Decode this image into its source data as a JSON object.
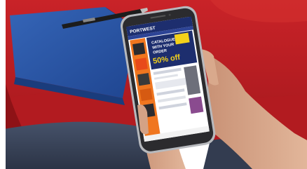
{
  "photo": {
    "subject": "hand-holding-smartphone",
    "colors": {
      "sofa": "#c21f24",
      "sofa_dark": "#8e1216",
      "notebook": "#2a57a8",
      "notebook_dark": "#1a3c7c",
      "pen": "#1a1a1a",
      "phone_frame": "#2b2b2e",
      "phone_edge": "#b7b9bd",
      "skin": "#d9a98c",
      "skin_shadow": "#b98466",
      "jeans": "#3a4458",
      "site_header": "#1d2e6e",
      "promo_orange": "#f0761f",
      "promo_yellow": "#f4d21a"
    }
  },
  "phone_screen": {
    "brand": "PORTWEST",
    "promo_line_1": "CATALOGUE",
    "promo_line_2": "WITH YOUR",
    "promo_line_3": "ORDER",
    "discount": "50% off"
  }
}
